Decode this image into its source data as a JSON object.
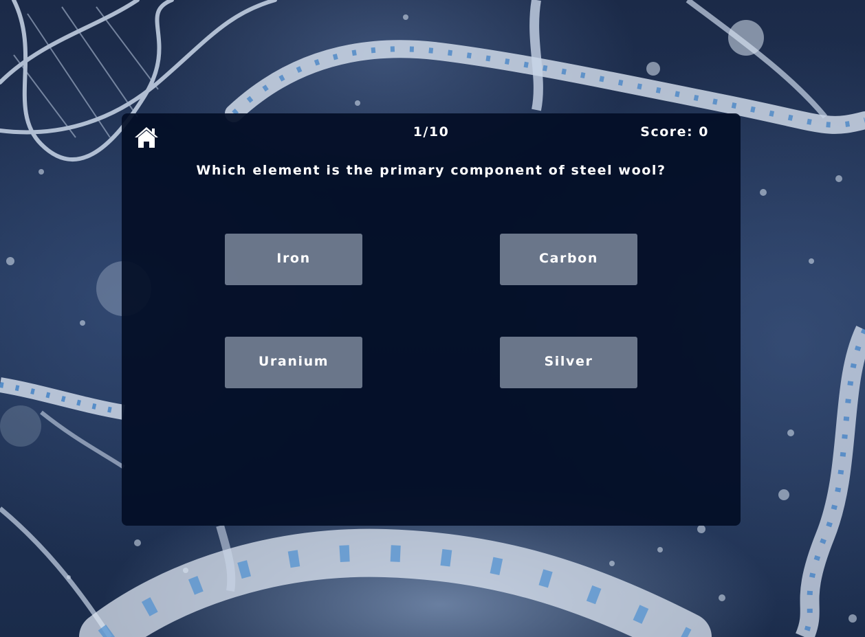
{
  "header": {
    "home_icon": "home-icon",
    "progress": "1/10",
    "score": "Score: 0"
  },
  "question": {
    "text": "Which element is the primary component of steel wool?"
  },
  "answers": [
    {
      "label": "Iron"
    },
    {
      "label": "Carbon"
    },
    {
      "label": "Uranium"
    },
    {
      "label": "Silver"
    }
  ],
  "colors": {
    "background": "#1b2a48",
    "card": "#030e26",
    "answer_button": "#c8d2e4",
    "text": "#ffffff"
  }
}
